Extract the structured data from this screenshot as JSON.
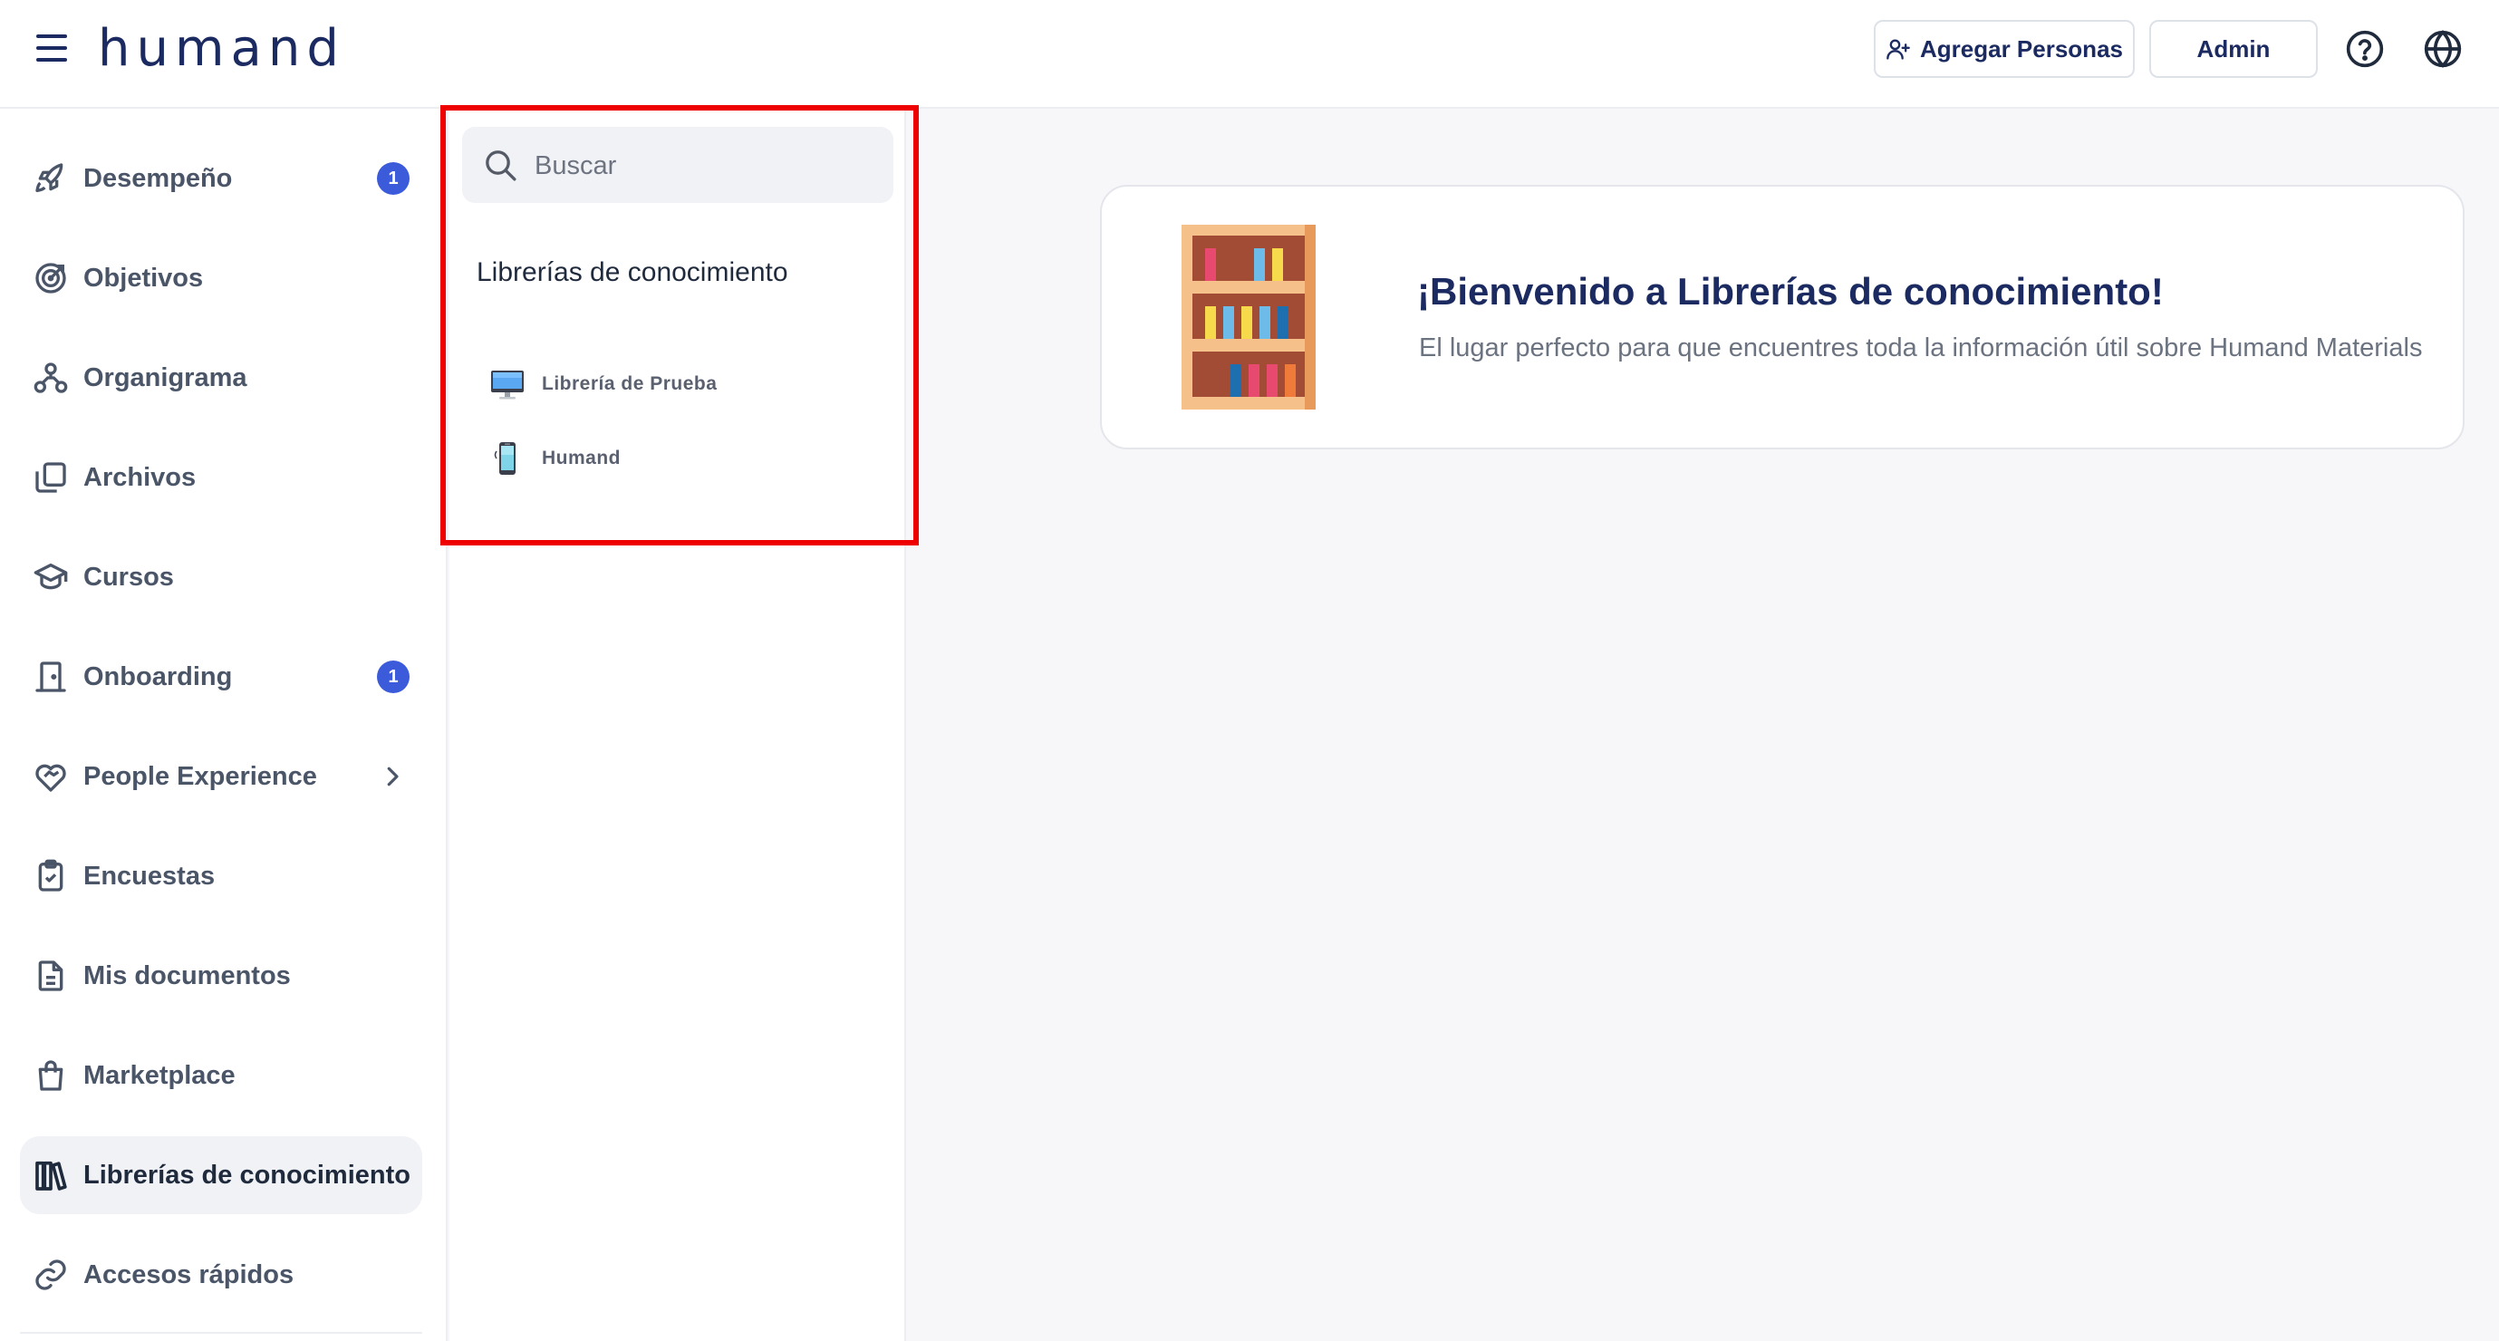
{
  "app": {
    "logo_text": "humand"
  },
  "header": {
    "add_people_label": "Agregar Personas",
    "admin_label": "Admin",
    "help_icon": "help-circle-icon",
    "language_icon": "globe-icon"
  },
  "sidebar": {
    "items": [
      {
        "label": "Desempeño",
        "icon": "rocket-icon",
        "badge": "1"
      },
      {
        "label": "Objetivos",
        "icon": "target-icon"
      },
      {
        "label": "Organigrama",
        "icon": "org-chart-icon"
      },
      {
        "label": "Archivos",
        "icon": "files-icon"
      },
      {
        "label": "Cursos",
        "icon": "graduation-cap-icon"
      },
      {
        "label": "Onboarding",
        "icon": "door-icon",
        "badge": "1"
      },
      {
        "label": "People Experience",
        "icon": "heart-handshake-icon",
        "has_submenu": true
      },
      {
        "label": "Encuestas",
        "icon": "clipboard-check-icon"
      },
      {
        "label": "Mis documentos",
        "icon": "document-icon"
      },
      {
        "label": "Marketplace",
        "icon": "shopping-bag-icon"
      },
      {
        "label": "Librerías de conocimiento",
        "icon": "library-books-icon",
        "active": true
      },
      {
        "label": "Accesos rápidos",
        "icon": "link-icon"
      }
    ]
  },
  "library_panel": {
    "search_placeholder": "Buscar",
    "title": "Librerías de conocimiento",
    "libraries": [
      {
        "label": "Librería de Prueba",
        "icon": "desktop-computer-icon"
      },
      {
        "label": "Humand",
        "icon": "mobile-phone-icon"
      }
    ]
  },
  "welcome": {
    "title": "¡Bienvenido a Librerías de conocimiento!",
    "subtitle": "El lugar perfecto para que encuentres toda la información útil sobre Humand Materials",
    "illustration": "bookshelf-icon"
  },
  "colors": {
    "brand": "#1b2a60",
    "badge": "#3b5bdb",
    "highlight": "#ee0000"
  }
}
